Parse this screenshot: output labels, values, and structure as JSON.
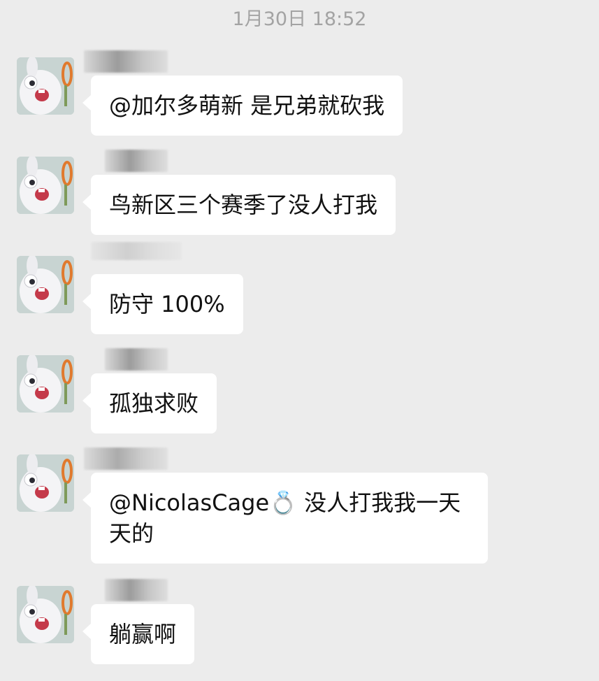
{
  "chat": {
    "timestamp": "1月30日 18:52",
    "messages": [
      {
        "avatar_icon": "white-rabbit-avatar-icon",
        "text": "@加尔多萌新 是兄弟就砍我"
      },
      {
        "avatar_icon": "white-rabbit-avatar-icon",
        "text": "鸟新区三个赛季了没人打我"
      },
      {
        "avatar_icon": "white-rabbit-avatar-icon",
        "text": "防守 100%"
      },
      {
        "avatar_icon": "white-rabbit-avatar-icon",
        "text": "孤独求败"
      },
      {
        "avatar_icon": "white-rabbit-avatar-icon",
        "text": "@NicolasCage💍 没人打我我一天天的"
      },
      {
        "avatar_icon": "white-rabbit-avatar-icon",
        "text": "躺赢啊"
      }
    ]
  },
  "colors": {
    "background": "#ececec",
    "bubble": "#ffffff",
    "timestamp_text": "#a3a3a3",
    "message_text": "#111111"
  }
}
